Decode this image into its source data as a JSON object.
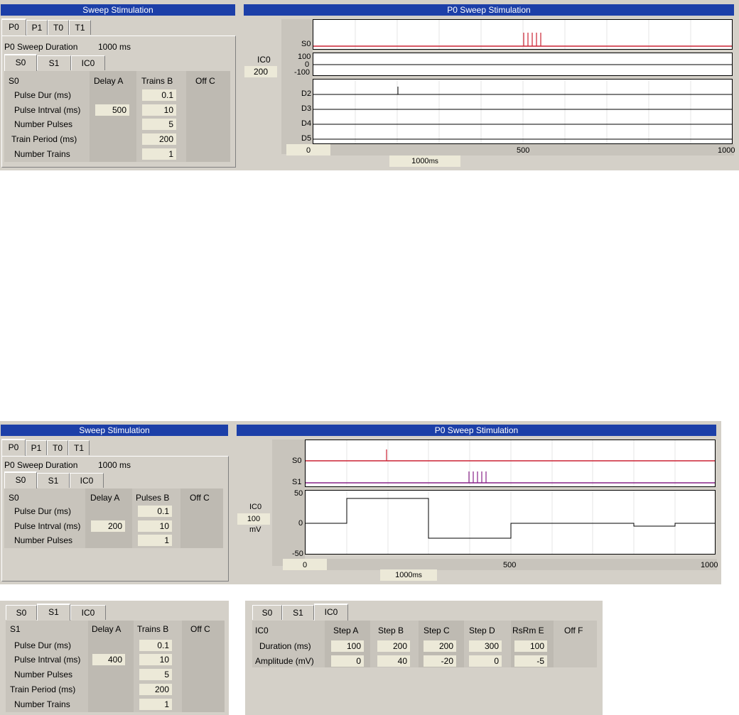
{
  "s1": {
    "left_title": "Sweep Stimulation",
    "right_title": "P0 Sweep Stimulation",
    "ptabs": [
      "P0",
      "P1",
      "T0",
      "T1"
    ],
    "duration_label": "P0 Sweep Duration",
    "duration_value": "1000 ms",
    "stabs": [
      "S0",
      "S1",
      "IC0"
    ],
    "header": {
      "name": "S0",
      "col_a": "Delay A",
      "col_b": "Trains B",
      "col_c": "Off C"
    },
    "rows": [
      {
        "label": "Pulse Dur (ms)",
        "a": "",
        "b": "0.1"
      },
      {
        "label": "Pulse Intrval (ms)",
        "a": "500",
        "b": "10"
      },
      {
        "label": "Number Pulses",
        "a": "",
        "b": "5"
      },
      {
        "label": "Train Period (ms)",
        "a": "",
        "b": "200"
      },
      {
        "label": "Number Trains",
        "a": "",
        "b": "1"
      }
    ],
    "plot": {
      "ch_s0": "S0",
      "ic_label": "IC0",
      "ic_range": "200",
      "ic_ticks": [
        "100",
        "0",
        "-100"
      ],
      "d_labels": [
        "D2",
        "D3",
        "D4",
        "D5"
      ],
      "x_ticks": [
        "0",
        "500",
        "1000"
      ],
      "x_input": "0",
      "x_unit_value": "1000",
      "x_unit": "ms"
    }
  },
  "s2": {
    "left_title": "Sweep Stimulation",
    "right_title": "P0 Sweep Stimulation",
    "ptabs": [
      "P0",
      "P1",
      "T0",
      "T1"
    ],
    "duration_label": "P0 Sweep Duration",
    "duration_value": "1000 ms",
    "stabs": [
      "S0",
      "S1",
      "IC0"
    ],
    "header": {
      "name": "S0",
      "col_a": "Delay A",
      "col_b": "Pulses B",
      "col_c": "Off C"
    },
    "rows": [
      {
        "label": "Pulse Dur (ms)",
        "a": "",
        "b": "0.1"
      },
      {
        "label": "Pulse Intrval (ms)",
        "a": "200",
        "b": "10"
      },
      {
        "label": "Number Pulses",
        "a": "",
        "b": "1"
      }
    ],
    "plot": {
      "ch_s0": "S0",
      "ch_s1": "S1",
      "ic_label": "IC0",
      "ic_range": "100",
      "ic_unit": "mV",
      "y_ticks": [
        "50",
        "0",
        "-50"
      ],
      "x_ticks": [
        "0",
        "500",
        "1000"
      ],
      "x_input": "0",
      "x_unit_value": "1000",
      "x_unit": "ms"
    }
  },
  "s3": {
    "stabs": [
      "S0",
      "S1",
      "IC0"
    ],
    "header": {
      "name": "S1",
      "col_a": "Delay A",
      "col_b": "Trains B",
      "col_c": "Off C"
    },
    "rows": [
      {
        "label": "Pulse Dur (ms)",
        "a": "",
        "b": "0.1"
      },
      {
        "label": "Pulse Intrval (ms)",
        "a": "400",
        "b": "10"
      },
      {
        "label": "Number Pulses",
        "a": "",
        "b": "5"
      },
      {
        "label": "Train Period (ms)",
        "a": "",
        "b": "200"
      },
      {
        "label": "Number Trains",
        "a": "",
        "b": "1"
      }
    ]
  },
  "s4": {
    "stabs": [
      "S0",
      "S1",
      "IC0"
    ],
    "header": {
      "name": "IC0",
      "cols": [
        "Step A",
        "Step B",
        "Step C",
        "Step D",
        "RsRm E",
        "Off F"
      ]
    },
    "rows": [
      {
        "label": "Duration (ms)",
        "values": [
          "100",
          "200",
          "200",
          "300",
          "100"
        ]
      },
      {
        "label": "Amplitude (mV)",
        "values": [
          "0",
          "40",
          "-20",
          "0",
          "-5"
        ]
      }
    ]
  },
  "colors": {
    "title_bar": "#1c3fa8",
    "panel": "#d4d0c8",
    "field": "#ece9d8",
    "s0_trace": "#cc2233",
    "s1_trace": "#882288"
  }
}
